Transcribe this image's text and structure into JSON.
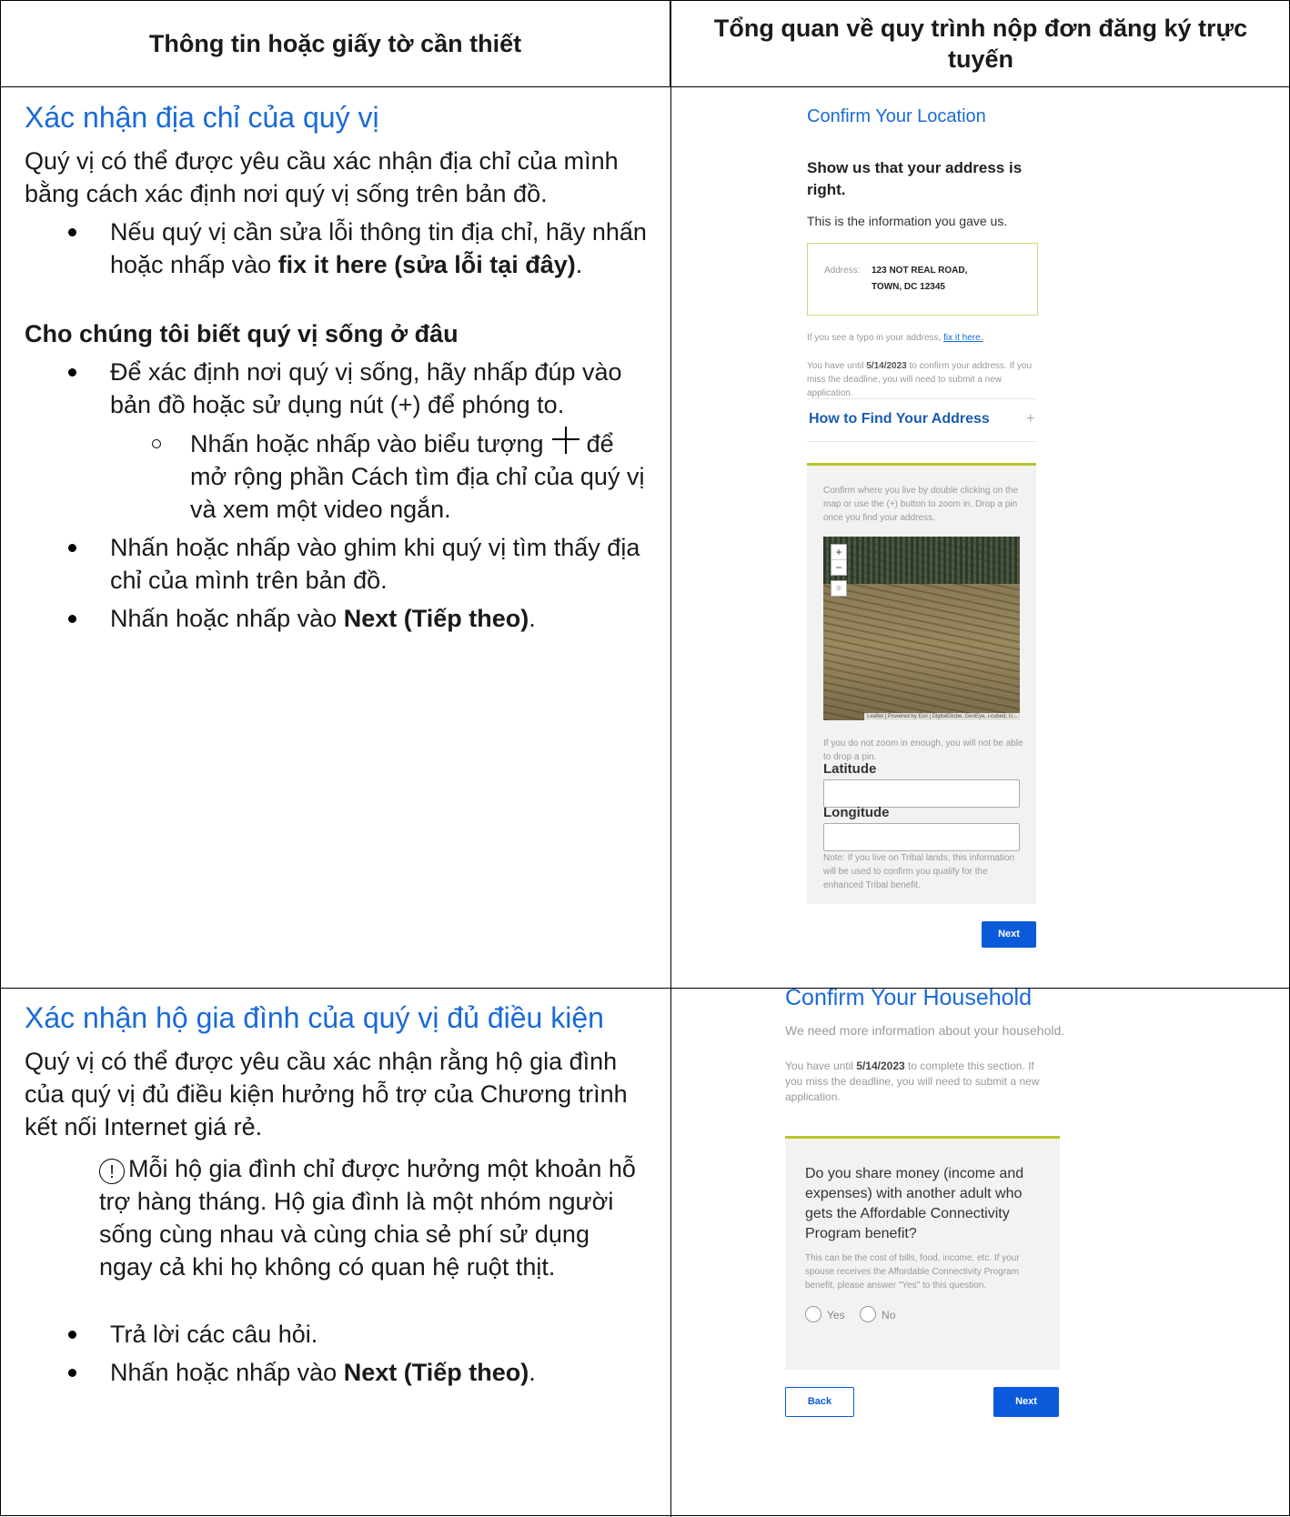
{
  "table": {
    "header_left": "Thông tin hoặc giấy tờ cần thiết",
    "header_right": "Tổng quan về quy trình nộp đơn đăng ký trực tuyến"
  },
  "section1": {
    "title": "Xác nhận địa chỉ của quý vị",
    "intro": "Quý vị có thể được yêu cầu xác nhận địa chỉ của mình bằng cách xác định nơi quý vị sống trên bản đồ.",
    "bullet1_pre": "Nếu quý vị cần sửa lỗi thông tin địa chỉ, hãy nhấn hoặc nhấp vào ",
    "bullet1_bold": "fix it here (sửa lỗi tại đây)",
    "bullet1_post": ".",
    "subheading": "Cho chúng tôi biết quý vị sống ở đâu",
    "bullet2": "Để xác định nơi quý vị sống, hãy nhấp đúp vào bản đồ hoặc sử dụng nút (+) để phóng to.",
    "sub_pre": "Nhấn hoặc nhấp vào biểu tượng ",
    "sub_post": " để mở rộng phần Cách tìm địa chỉ của quý vị và xem một video ngắn.",
    "bullet3": "Nhấn hoặc nhấp vào ghim khi quý vị tìm thấy địa chỉ của mình trên bản đồ.",
    "bullet4_pre": "Nhấn hoặc nhấp vào ",
    "bullet4_bold": "Next (Tiếp theo)",
    "bullet4_post": "."
  },
  "section2": {
    "title": "Xác nhận hộ gia đình của quý vị đủ điều kiện",
    "intro": "Quý vị có thể được yêu cầu xác nhận rằng hộ gia đình của quý vị đủ điều kiện hưởng hỗ trợ của Chương trình kết nối Internet giá rẻ.",
    "note_icon": "!",
    "note": "Mỗi hộ gia đình chỉ được hưởng một khoản hỗ trợ hàng tháng. Hộ gia đình là một nhóm người sống cùng nhau và cùng chia sẻ phí sử dụng ngay cả khi họ không có quan hệ ruột thịt.",
    "bullet1": "Trả lời các câu hỏi.",
    "bullet2_pre": "Nhấn hoặc nhấp vào ",
    "bullet2_bold": "Next (Tiếp theo)",
    "bullet2_post": "."
  },
  "mock_location": {
    "title": "Confirm Your Location",
    "heading": "Show us that your address is right.",
    "info": "This is the information you gave us.",
    "address_label": "Address:",
    "address_line1": "123 NOT REAL ROAD,",
    "address_line2": "TOWN, DC 12345",
    "typo_pre": "If you see a typo in your address, ",
    "typo_link": "fix it here.",
    "deadline_pre": "You have until ",
    "deadline_date": "5/14/2023",
    "deadline_post": " to confirm your address. If you miss the deadline, you will need to submit a new application.",
    "accordion": "How to Find Your Address",
    "accordion_icon": "+",
    "panel_text": "Confirm where you live by double clicking on the map or use the (+) button to zoom in. Drop a pin once you find your address.",
    "zoom_in": "+",
    "zoom_out": "−",
    "pin_icon": "⌾",
    "map_attribution": "Leaflet | Powered by Esri | DigitalGlobe, GeoEye, i-cubed, U...",
    "zoom_note": "If you do not zoom in enough, you will not be able to drop a pin.",
    "latitude_label": "Latitude",
    "longitude_label": "Longitude",
    "tribal_note": "Note: If you live on Tribal lands, this information will be used to confirm you qualify for the enhanced Tribal benefit.",
    "next": "Next"
  },
  "mock_household": {
    "title": "Confirm Your Household",
    "info": "We need more information about your household.",
    "deadline_pre": "You have until ",
    "deadline_date": "5/14/2023",
    "deadline_post": " to complete this section. If you miss the deadline, you will need to submit a new application.",
    "question": "Do you share money (income and expenses) with another adult who gets the Affordable Connectivity Program benefit?",
    "help": "This can be the cost of bills, food, income, etc. If your spouse receives the Affordable Connectivity Program benefit, please answer \"Yes\" to this question.",
    "yes": "Yes",
    "no": "No",
    "back": "Back",
    "next": "Next"
  }
}
